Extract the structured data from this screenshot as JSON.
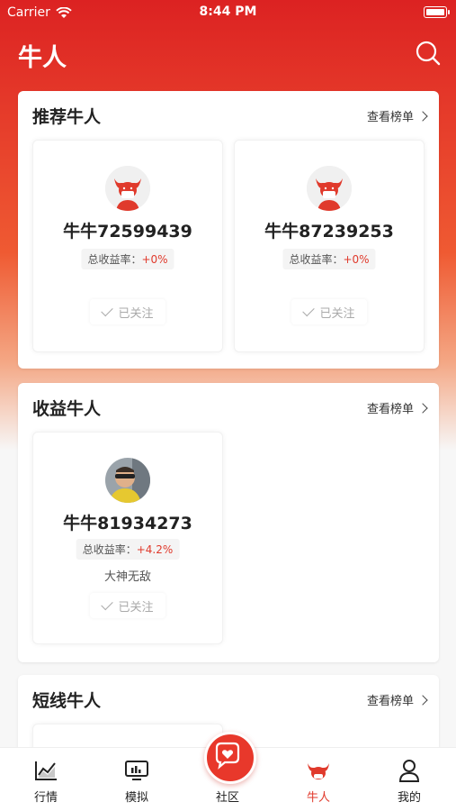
{
  "status_bar": {
    "carrier": "Carrier",
    "time": "8:44 PM"
  },
  "header": {
    "title": "牛人"
  },
  "sections": [
    {
      "title": "推荐牛人",
      "more": "查看榜单",
      "people": [
        {
          "name": "牛牛72599439",
          "rate_label": "总收益率：",
          "rate_value": "+0%",
          "follow": "已关注"
        },
        {
          "name": "牛牛87239253",
          "rate_label": "总收益率：",
          "rate_value": "+0%",
          "follow": "已关注"
        }
      ]
    },
    {
      "title": "收益牛人",
      "more": "查看榜单",
      "people": [
        {
          "name": "牛牛81934273",
          "rate_label": "总收益率：",
          "rate_value": "+4.2%",
          "motto": "大神无敌",
          "follow": "已关注"
        }
      ]
    },
    {
      "title": "短线牛人",
      "more": "查看榜单"
    }
  ],
  "tabbar": {
    "items": [
      {
        "label": "行情",
        "icon": "chart-trend-icon"
      },
      {
        "label": "模拟",
        "icon": "monitor-icon"
      },
      {
        "label": "社区",
        "icon": "heart-chat-icon"
      },
      {
        "label": "牛人",
        "icon": "bull-icon",
        "active": true
      },
      {
        "label": "我的",
        "icon": "user-icon"
      }
    ]
  },
  "colors": {
    "brand_red": "#e03a2c",
    "gain_red": "#e03a2c",
    "muted": "#aaaaaa"
  }
}
